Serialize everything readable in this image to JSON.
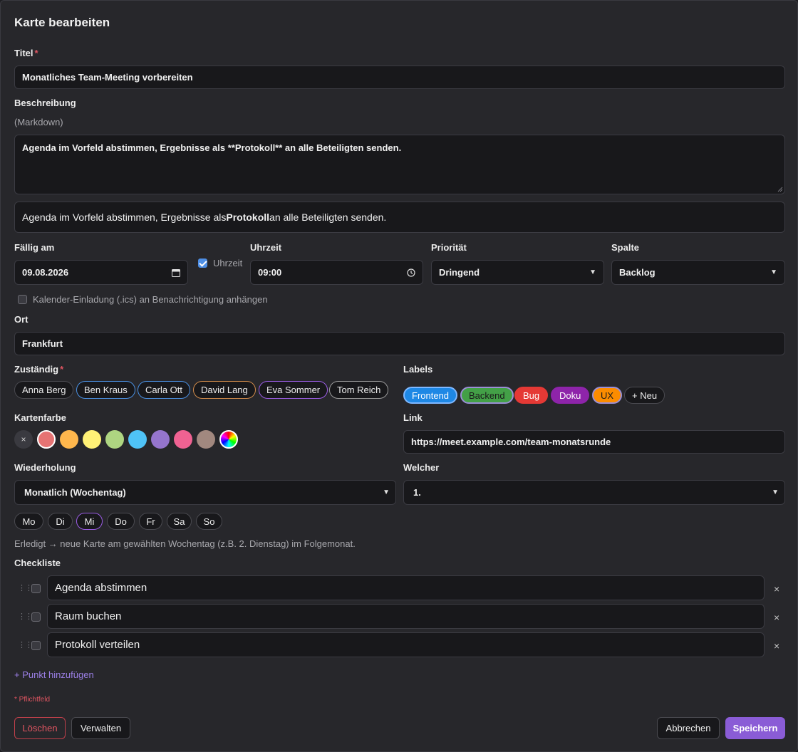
{
  "dialog": {
    "title": "Karte bearbeiten"
  },
  "title_field": {
    "label": "Titel",
    "value": "Monatliches Team-Meeting vorbereiten"
  },
  "description": {
    "label": "Beschreibung",
    "hint": "(Markdown)",
    "value": "Agenda im Vorfeld abstimmen, Ergebnisse als **Protokoll** an alle Beteiligten senden.",
    "preview_before": "Agenda im Vorfeld abstimmen, Ergebnisse als ",
    "preview_bold": "Protokoll",
    "preview_after": " an alle Beteiligten senden."
  },
  "due": {
    "label": "Fällig am",
    "value": "09.08.2026",
    "time_toggle_label": "Uhrzeit",
    "time_toggle_checked": true
  },
  "time": {
    "label": "Uhrzeit",
    "value": "09:00"
  },
  "priority": {
    "label": "Priorität",
    "value": "Dringend"
  },
  "column": {
    "label": "Spalte",
    "value": "Backlog"
  },
  "calendar_invite": {
    "label": "Kalender-Einladung (.ics) an Benachrichtigung anhängen",
    "checked": false
  },
  "location": {
    "label": "Ort",
    "value": "Frankfurt"
  },
  "assignees": {
    "label": "Zuständig",
    "people": [
      {
        "name": "Anna Berg",
        "border": "#4a4a50"
      },
      {
        "name": "Ben Kraus",
        "border": "#4a90e2"
      },
      {
        "name": "Carla Ott",
        "border": "#4a90e2"
      },
      {
        "name": "David Lang",
        "border": "#d08a4a"
      },
      {
        "name": "Eva Sommer",
        "border": "#9b5de5"
      },
      {
        "name": "Tom Reich",
        "border": "#9a9a9a"
      }
    ]
  },
  "labels": {
    "label": "Labels",
    "items": [
      {
        "name": "Frontend",
        "bg": "#1e88e5",
        "border": "#7fb8ff",
        "color": "#ffffff"
      },
      {
        "name": "Backend",
        "bg": "#43a047",
        "border": "#9b8fd6",
        "color": "#1a1a1a"
      },
      {
        "name": "Bug",
        "bg": "#e53935",
        "border": "#e53935",
        "color": "#ffffff"
      },
      {
        "name": "Doku",
        "bg": "#8e24aa",
        "border": "#8e24aa",
        "color": "#ffffff"
      },
      {
        "name": "UX",
        "bg": "#fb8c00",
        "border": "#9b8fd6",
        "color": "#1a1a1a"
      }
    ],
    "add_label": "+ Neu"
  },
  "card_color": {
    "label": "Kartenfarbe",
    "clear_symbol": "×",
    "colors": [
      "#e57373",
      "#ffb74d",
      "#fff176",
      "#aed581",
      "#4fc3f7",
      "#9575cd",
      "#f06292",
      "#a1887f"
    ],
    "selected": "#e57373"
  },
  "link": {
    "label": "Link",
    "value": "https://meet.example.com/team-monatsrunde"
  },
  "recurrence": {
    "label": "Wiederholung",
    "value": "Monatlich (Wochentag)"
  },
  "which": {
    "label": "Welcher",
    "value": "1."
  },
  "weekdays": {
    "days": [
      "Mo",
      "Di",
      "Mi",
      "Do",
      "Fr",
      "Sa",
      "So"
    ],
    "selected": "Mi"
  },
  "recurrence_hint": "Erledigt → neue Karte am gewählten Wochentag (z.B. 2. Dienstag) im Folgemonat.",
  "checklist": {
    "label": "Checkliste",
    "items": [
      {
        "text": "Agenda abstimmen",
        "done": false
      },
      {
        "text": "Raum buchen",
        "done": false
      },
      {
        "text": "Protokoll verteilen",
        "done": false
      }
    ],
    "remove_symbol": "×",
    "add_label": "+ Punkt hinzufügen"
  },
  "required_note": "* Pflichtfeld",
  "footer": {
    "delete": "Löschen",
    "manage": "Verwalten",
    "cancel": "Abbrechen",
    "save": "Speichern"
  },
  "colors": {
    "accent": "#8a5cd6",
    "danger": "#e05561",
    "link": "#9b7fe6"
  }
}
